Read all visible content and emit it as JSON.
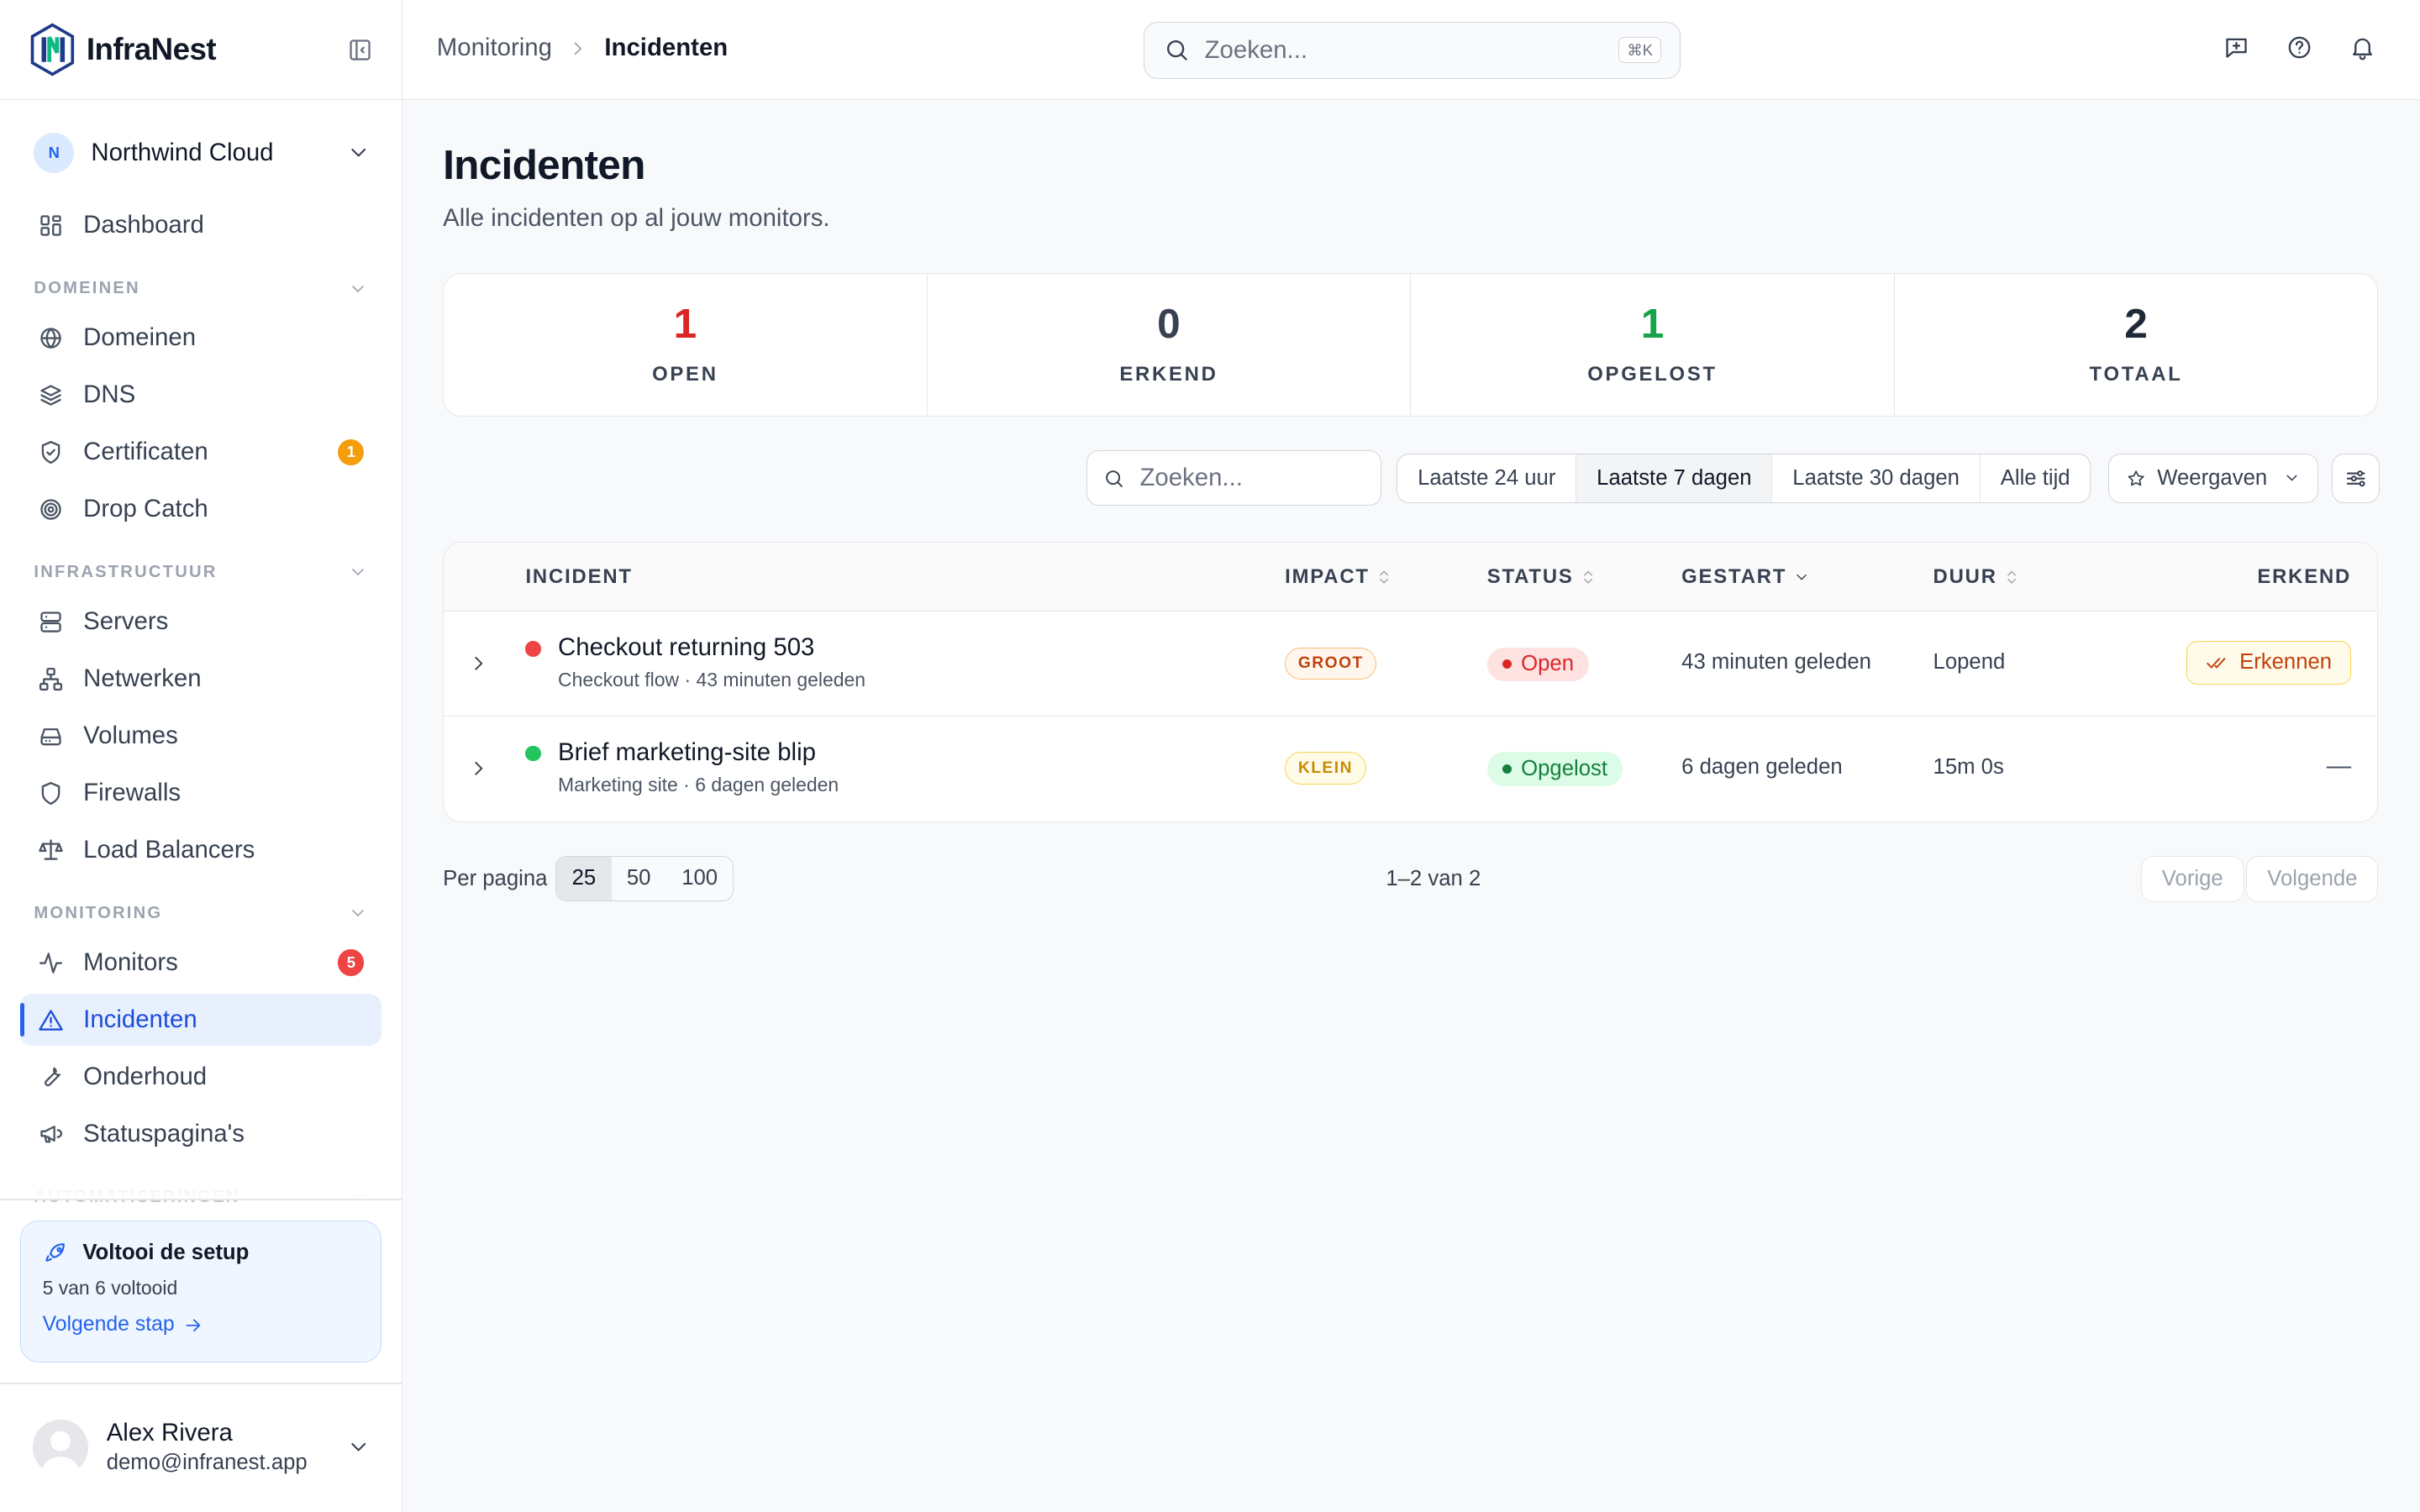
{
  "brand": {
    "name": "InfraNest"
  },
  "org": {
    "initial": "N",
    "name": "Northwind Cloud"
  },
  "nav": {
    "dashboard": "Dashboard",
    "sections": {
      "domains": "DOMEINEN",
      "infrastructure": "INFRASTRUCTUUR",
      "monitoring": "MONITORING",
      "automation": "AUTOMATISERINGEN"
    },
    "domains": "Domeinen",
    "dns": "DNS",
    "certificates": "Certificaten",
    "certificates_badge": "1",
    "dropcatch": "Drop Catch",
    "servers": "Servers",
    "networks": "Netwerken",
    "volumes": "Volumes",
    "firewalls": "Firewalls",
    "loadbalancers": "Load Balancers",
    "monitors": "Monitors",
    "monitors_badge": "5",
    "incidents": "Incidenten",
    "maintenance": "Onderhoud",
    "statuspages": "Statuspagina's"
  },
  "setup": {
    "title": "Voltooi de setup",
    "progress": "5 van 6 voltooid",
    "next": "Volgende stap"
  },
  "user": {
    "name": "Alex Rivera",
    "email": "demo@infranest.app"
  },
  "breadcrumb": {
    "parent": "Monitoring",
    "current": "Incidenten"
  },
  "search": {
    "placeholder": "Zoeken...",
    "shortcut": "⌘K"
  },
  "page": {
    "title": "Incidenten",
    "subtitle": "Alle incidenten op al jouw monitors."
  },
  "stats": [
    {
      "value": "1",
      "label": "OPEN",
      "color": "#dc2626"
    },
    {
      "value": "0",
      "label": "ERKEND",
      "color": "#374151"
    },
    {
      "value": "1",
      "label": "OPGELOST",
      "color": "#16a34a"
    },
    {
      "value": "2",
      "label": "TOTAAL",
      "color": "#1f2937"
    }
  ],
  "filters": {
    "search_placeholder": "Zoeken...",
    "ranges": [
      "Laatste 24 uur",
      "Laatste 7 dagen",
      "Laatste 30 dagen",
      "Alle tijd"
    ],
    "selected_range": "Laatste 7 dagen",
    "views": "Weergaven"
  },
  "table": {
    "columns": {
      "incident": "INCIDENT",
      "impact": "IMPACT",
      "status": "STATUS",
      "started": "GESTART",
      "duration": "DUUR",
      "acknowledged": "ERKEND"
    },
    "rows": [
      {
        "title": "Checkout returning 503",
        "monitor": "Checkout flow",
        "age": "43 minuten geleden",
        "impact": "GROOT",
        "status": "Open",
        "started": "43 minuten geleden",
        "duration": "Lopend",
        "ack": "Erkennen",
        "dot_color": "#ef4444"
      },
      {
        "title": "Brief marketing-site blip",
        "monitor": "Marketing site",
        "age": "6 dagen geleden",
        "impact": "KLEIN",
        "status": "Opgelost",
        "started": "6 dagen geleden",
        "duration": "15m 0s",
        "ack": "—",
        "dot_color": "#22c55e"
      }
    ]
  },
  "pagination": {
    "per_page_label": "Per pagina",
    "sizes": [
      "25",
      "50",
      "100"
    ],
    "selected": "25",
    "count": "1–2 van 2",
    "prev": "Vorige",
    "next": "Volgende"
  }
}
